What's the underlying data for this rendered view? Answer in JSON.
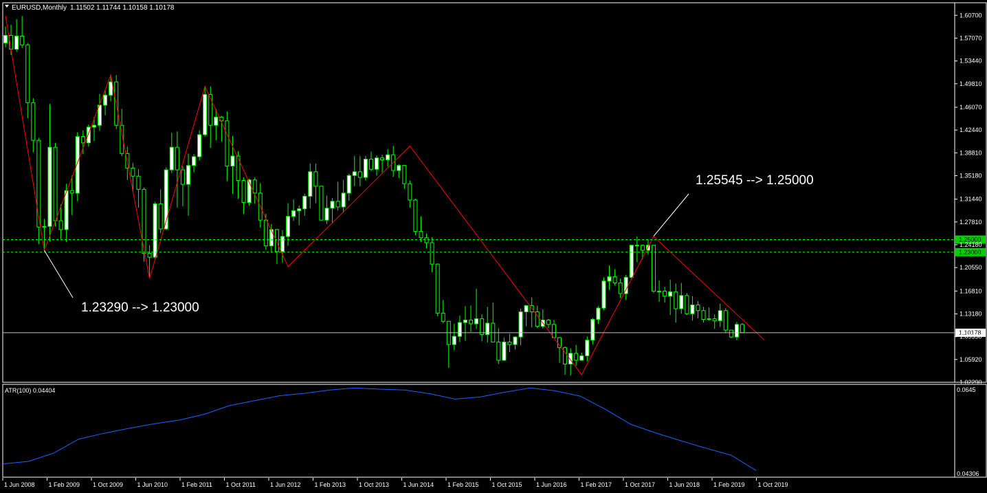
{
  "header": {
    "symbol_label": "EURUSD,Monthly",
    "ohlc": "1.11502 1.11744 1.10158 1.10178"
  },
  "indicator": {
    "label": "ATR(100) 0.04404",
    "axis_top": "0.0645",
    "axis_bottom": "0.04306"
  },
  "price_axis": {
    "labels": [
      "1.60700",
      "1.57070",
      "1.53440",
      "1.49810",
      "1.46070",
      "1.42440",
      "1.38810",
      "1.35180",
      "1.31440",
      "1.27810",
      "1.24180",
      "1.20550",
      "1.16810",
      "1.13180",
      "1.09550",
      "1.05920",
      "1.02290"
    ],
    "values": [
      1.607,
      1.5707,
      1.5344,
      1.4981,
      1.4607,
      1.4244,
      1.3881,
      1.3518,
      1.3144,
      1.2781,
      1.2418,
      1.2055,
      1.1681,
      1.1318,
      1.0955,
      1.0592,
      1.0229
    ],
    "range": [
      1.0229,
      1.627
    ]
  },
  "levels": {
    "upper": {
      "value": 1.25,
      "label": "1.25000"
    },
    "lower": {
      "value": 1.23,
      "label": "1.23000"
    },
    "current": {
      "value": 1.10178,
      "label": "1.10178"
    }
  },
  "annotations": {
    "low_note": "1.23290 --> 1.23000",
    "high_note": "1.25545 --> 1.25000",
    "low_point": {
      "date": "2008-11",
      "price": 1.2329
    },
    "high_point": {
      "date": "2018-01",
      "price": 1.25545
    }
  },
  "time_axis": {
    "labels": [
      "1 Jun 2008",
      "1 Feb 2009",
      "1 Oct 2009",
      "1 Jun 2010",
      "1 Feb 2011",
      "1 Oct 2011",
      "1 Jun 2012",
      "1 Feb 2013",
      "1 Oct 2013",
      "1 Jun 2014",
      "1 Feb 2015",
      "1 Oct 2015",
      "1 Jun 2016",
      "1 Feb 2017",
      "1 Oct 2017",
      "1 Jun 2018",
      "1 Feb 2019",
      "1 Oct 2019"
    ]
  },
  "colors": {
    "background": "#000000",
    "bull_candle": "#ffffff",
    "bear_candle": "#000000",
    "wick": "#00ff00",
    "zigzag": "#ff0000",
    "level_line": "#00ff00",
    "level_badge": "#00d000",
    "atr_line": "#1e60ff",
    "axis": "#ffffff"
  },
  "chart_data": {
    "type": "candlestick",
    "first_candle": "2008-04",
    "candles": [
      [
        1.563,
        1.589,
        1.556,
        1.575
      ],
      [
        1.575,
        1.592,
        1.544,
        1.553
      ],
      [
        1.553,
        1.601,
        1.549,
        1.574
      ],
      [
        1.574,
        1.606,
        1.555,
        1.56
      ],
      [
        1.56,
        1.563,
        1.443,
        1.468
      ],
      [
        1.468,
        1.475,
        1.389,
        1.408
      ],
      [
        1.408,
        1.412,
        1.243,
        1.27
      ],
      [
        1.27,
        1.283,
        1.233,
        1.271
      ],
      [
        1.271,
        1.466,
        1.247,
        1.397
      ],
      [
        1.397,
        1.404,
        1.271,
        1.28
      ],
      [
        1.28,
        1.306,
        1.251,
        1.266
      ],
      [
        1.266,
        1.339,
        1.246,
        1.328
      ],
      [
        1.328,
        1.352,
        1.289,
        1.324
      ],
      [
        1.324,
        1.421,
        1.311,
        1.414
      ],
      [
        1.414,
        1.424,
        1.386,
        1.404
      ],
      [
        1.404,
        1.433,
        1.398,
        1.429
      ],
      [
        1.429,
        1.445,
        1.407,
        1.432
      ],
      [
        1.432,
        1.482,
        1.423,
        1.464
      ],
      [
        1.464,
        1.487,
        1.448,
        1.48
      ],
      [
        1.48,
        1.513,
        1.47,
        1.501
      ],
      [
        1.501,
        1.512,
        1.426,
        1.432
      ],
      [
        1.432,
        1.458,
        1.383,
        1.387
      ],
      [
        1.387,
        1.398,
        1.345,
        1.364
      ],
      [
        1.364,
        1.372,
        1.326,
        1.351
      ],
      [
        1.351,
        1.362,
        1.301,
        1.33
      ],
      [
        1.33,
        1.333,
        1.215,
        1.228
      ],
      [
        1.228,
        1.241,
        1.188,
        1.222
      ],
      [
        1.222,
        1.31,
        1.218,
        1.307
      ],
      [
        1.307,
        1.33,
        1.26,
        1.267
      ],
      [
        1.267,
        1.365,
        1.265,
        1.361
      ],
      [
        1.361,
        1.42,
        1.356,
        1.397
      ],
      [
        1.397,
        1.422,
        1.301,
        1.361
      ],
      [
        1.361,
        1.367,
        1.303,
        1.338
      ],
      [
        1.338,
        1.387,
        1.288,
        1.368
      ],
      [
        1.368,
        1.386,
        1.357,
        1.382
      ],
      [
        1.382,
        1.424,
        1.376,
        1.417
      ],
      [
        1.417,
        1.494,
        1.414,
        1.481
      ],
      [
        1.481,
        1.494,
        1.396,
        1.432
      ],
      [
        1.432,
        1.458,
        1.408,
        1.445
      ],
      [
        1.445,
        1.447,
        1.406,
        1.439
      ],
      [
        1.439,
        1.454,
        1.343,
        1.367
      ],
      [
        1.367,
        1.415,
        1.323,
        1.383
      ],
      [
        1.383,
        1.391,
        1.315,
        1.344
      ],
      [
        1.344,
        1.349,
        1.291,
        1.309
      ],
      [
        1.309,
        1.347,
        1.304,
        1.345
      ],
      [
        1.345,
        1.349,
        1.307,
        1.324
      ],
      [
        1.324,
        1.34,
        1.269,
        1.281
      ],
      [
        1.281,
        1.291,
        1.234,
        1.24
      ],
      [
        1.24,
        1.275,
        1.23,
        1.266
      ],
      [
        1.266,
        1.267,
        1.211,
        1.231
      ],
      [
        1.231,
        1.265,
        1.213,
        1.255
      ],
      [
        1.255,
        1.308,
        1.24,
        1.287
      ],
      [
        1.287,
        1.314,
        1.28,
        1.296
      ],
      [
        1.296,
        1.304,
        1.273,
        1.299
      ],
      [
        1.299,
        1.323,
        1.288,
        1.319
      ],
      [
        1.319,
        1.371,
        1.3,
        1.358
      ],
      [
        1.358,
        1.371,
        1.308,
        1.335
      ],
      [
        1.335,
        1.315,
        1.283,
        1.281
      ],
      [
        1.281,
        1.32,
        1.275,
        1.3
      ],
      [
        1.3,
        1.316,
        1.276,
        1.311
      ],
      [
        1.311,
        1.342,
        1.296,
        1.302
      ],
      [
        1.302,
        1.345,
        1.293,
        1.324
      ],
      [
        1.324,
        1.355,
        1.312,
        1.352
      ],
      [
        1.352,
        1.383,
        1.335,
        1.358
      ],
      [
        1.358,
        1.383,
        1.335,
        1.349
      ],
      [
        1.349,
        1.383,
        1.344,
        1.378
      ],
      [
        1.378,
        1.39,
        1.359,
        1.362
      ],
      [
        1.362,
        1.384,
        1.352,
        1.38
      ],
      [
        1.38,
        1.385,
        1.357,
        1.377
      ],
      [
        1.377,
        1.394,
        1.366,
        1.385
      ],
      [
        1.385,
        1.399,
        1.35,
        1.36
      ],
      [
        1.36,
        1.37,
        1.348,
        1.368
      ],
      [
        1.368,
        1.369,
        1.331,
        1.339
      ],
      [
        1.339,
        1.344,
        1.301,
        1.313
      ],
      [
        1.313,
        1.315,
        1.257,
        1.263
      ],
      [
        1.263,
        1.287,
        1.246,
        1.253
      ],
      [
        1.253,
        1.26,
        1.236,
        1.245
      ],
      [
        1.245,
        1.254,
        1.198,
        1.211
      ],
      [
        1.211,
        1.212,
        1.128,
        1.133
      ],
      [
        1.133,
        1.154,
        1.117,
        1.12
      ],
      [
        1.12,
        1.108,
        1.046,
        1.083
      ],
      [
        1.083,
        1.116,
        1.074,
        1.096
      ],
      [
        1.096,
        1.129,
        1.087,
        1.118
      ],
      [
        1.118,
        1.144,
        1.089,
        1.122
      ],
      [
        1.122,
        1.145,
        1.103,
        1.116
      ],
      [
        1.116,
        1.172,
        1.108,
        1.124
      ],
      [
        1.124,
        1.131,
        1.088,
        1.099
      ],
      [
        1.099,
        1.143,
        1.086,
        1.117
      ],
      [
        1.117,
        1.15,
        1.106,
        1.087
      ],
      [
        1.087,
        1.109,
        1.052,
        1.058
      ],
      [
        1.058,
        1.094,
        1.057,
        1.087
      ],
      [
        1.087,
        1.1,
        1.071,
        1.083
      ],
      [
        1.083,
        1.096,
        1.075,
        1.095
      ],
      [
        1.095,
        1.14,
        1.082,
        1.135
      ],
      [
        1.135,
        1.146,
        1.112,
        1.145
      ],
      [
        1.145,
        1.158,
        1.11,
        1.135
      ],
      [
        1.135,
        1.145,
        1.109,
        1.112
      ],
      [
        1.112,
        1.139,
        1.109,
        1.122
      ],
      [
        1.122,
        1.124,
        1.109,
        1.115
      ],
      [
        1.115,
        1.122,
        1.094,
        1.094
      ],
      [
        1.094,
        1.095,
        1.054,
        1.078
      ],
      [
        1.078,
        1.08,
        1.035,
        1.052
      ],
      [
        1.052,
        1.077,
        1.034,
        1.069
      ],
      [
        1.069,
        1.082,
        1.049,
        1.058
      ],
      [
        1.058,
        1.07,
        1.057,
        1.065
      ],
      [
        1.065,
        1.096,
        1.056,
        1.09
      ],
      [
        1.09,
        1.125,
        1.083,
        1.123
      ],
      [
        1.123,
        1.144,
        1.116,
        1.141
      ],
      [
        1.141,
        1.19,
        1.138,
        1.184
      ],
      [
        1.184,
        1.209,
        1.17,
        1.191
      ],
      [
        1.191,
        1.203,
        1.177,
        1.181
      ],
      [
        1.181,
        1.188,
        1.157,
        1.164
      ],
      [
        1.164,
        1.194,
        1.154,
        1.19
      ],
      [
        1.19,
        1.23,
        1.186,
        1.241
      ],
      [
        1.241,
        1.255,
        1.214,
        1.241
      ],
      [
        1.241,
        1.242,
        1.219,
        1.233
      ],
      [
        1.233,
        1.25,
        1.226,
        1.241
      ],
      [
        1.241,
        1.239,
        1.165,
        1.168
      ],
      [
        1.168,
        1.185,
        1.151,
        1.168
      ],
      [
        1.168,
        1.175,
        1.15,
        1.16
      ],
      [
        1.16,
        1.186,
        1.13,
        1.167
      ],
      [
        1.167,
        1.18,
        1.118,
        1.14
      ],
      [
        1.14,
        1.181,
        1.132,
        1.161
      ],
      [
        1.161,
        1.165,
        1.13,
        1.132
      ],
      [
        1.132,
        1.16,
        1.121,
        1.146
      ],
      [
        1.146,
        1.152,
        1.125,
        1.137
      ],
      [
        1.137,
        1.143,
        1.118,
        1.123
      ],
      [
        1.123,
        1.142,
        1.121,
        1.124
      ],
      [
        1.124,
        1.131,
        1.108,
        1.121
      ],
      [
        1.121,
        1.148,
        1.111,
        1.137
      ],
      [
        1.137,
        1.141,
        1.101,
        1.106
      ],
      [
        1.106,
        1.103,
        1.093,
        1.095
      ],
      [
        1.095,
        1.119,
        1.09,
        1.115
      ],
      [
        1.115,
        1.117,
        1.102,
        1.102
      ]
    ],
    "zigzag": [
      [
        "2008-04",
        1.606
      ],
      [
        "2008-11",
        1.233
      ],
      [
        "2009-11",
        1.512
      ],
      [
        "2010-06",
        1.188
      ],
      [
        "2011-04",
        1.494
      ],
      [
        "2012-07",
        1.207
      ],
      [
        "2014-05",
        1.399
      ],
      [
        "2016-12",
        1.035
      ],
      [
        "2018-01",
        1.255
      ],
      [
        "2019-09",
        1.09
      ]
    ],
    "atr": [
      0.0459,
      0.0465,
      0.0485,
      0.0519,
      0.0533,
      0.0545,
      0.0556,
      0.0565,
      0.0579,
      0.06,
      0.0612,
      0.0624,
      0.063,
      0.0638,
      0.0643,
      0.064,
      0.0638,
      0.0629,
      0.0616,
      0.0621,
      0.0633,
      0.0643,
      0.0636,
      0.0623,
      0.0591,
      0.0555,
      0.0534,
      0.0515,
      0.0497,
      0.048,
      0.0443
    ],
    "atr_range": [
      0.043,
      0.065
    ]
  }
}
